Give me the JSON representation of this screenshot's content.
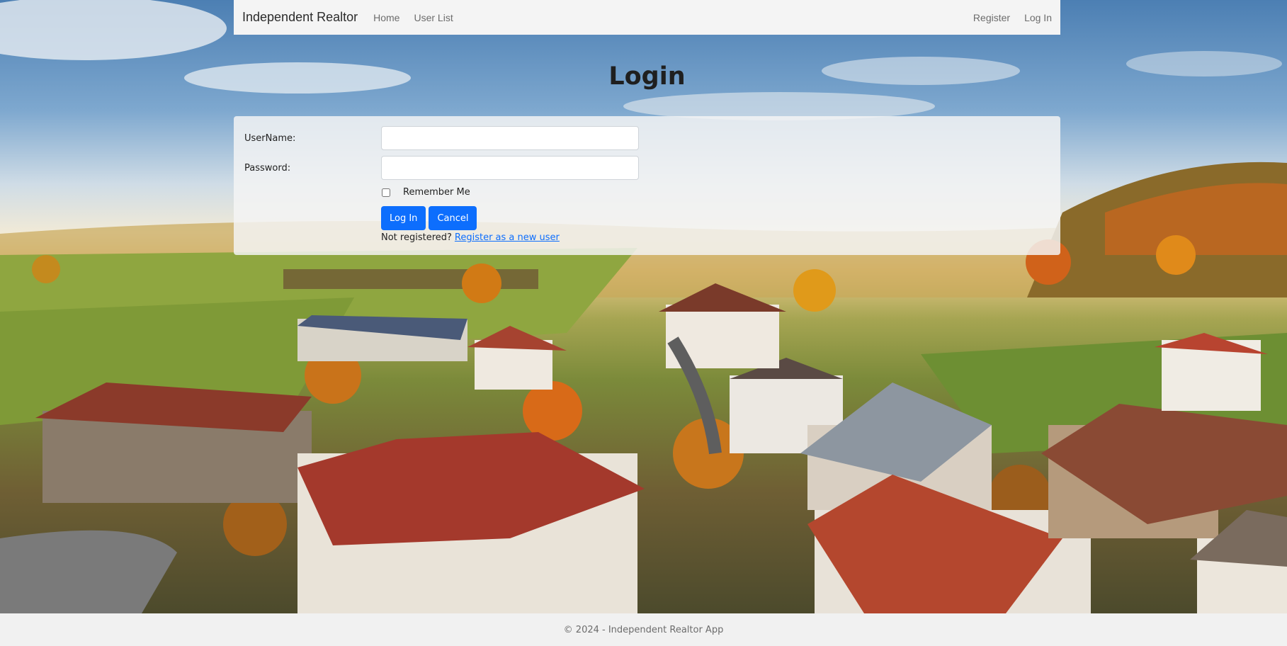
{
  "navbar": {
    "brand": "Independent Realtor",
    "links": [
      "Home",
      "User List"
    ],
    "right_links": [
      "Register",
      "Log In"
    ]
  },
  "page": {
    "title": "Login"
  },
  "form": {
    "username_label": "UserName:",
    "username_value": "",
    "password_label": "Password:",
    "password_value": "",
    "remember_label": "Remember Me",
    "remember_checked": false,
    "login_button": "Log In",
    "cancel_button": "Cancel",
    "not_registered_text": "Not registered?",
    "register_link": "Register as a new user"
  },
  "footer": {
    "text": "© 2024 - Independent Realtor App"
  },
  "colors": {
    "primary": "#0d6efd",
    "navbar_bg": "#f4f4f4",
    "footer_bg": "#f1f1f1"
  }
}
